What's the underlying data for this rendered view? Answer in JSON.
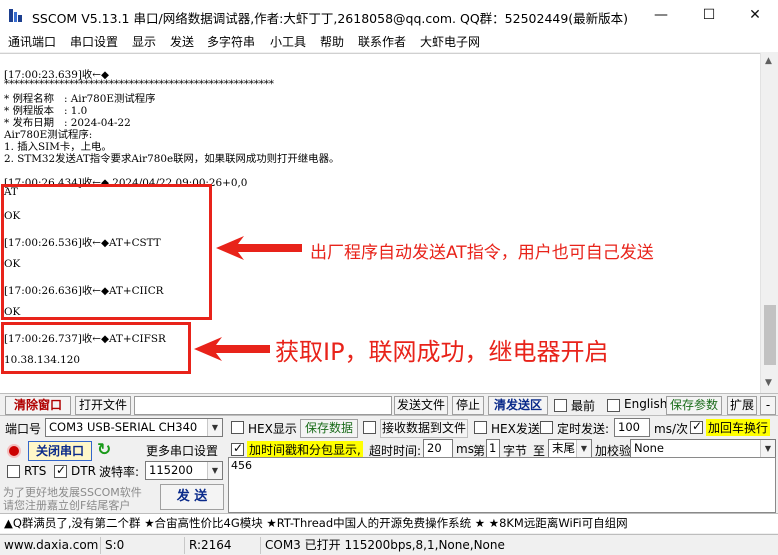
{
  "window": {
    "title": "SSCOM V5.13.1 串口/网络数据调试器,作者:大虾丁丁,2618058@qq.com. QQ群：52502449(最新版本)",
    "controls": {
      "minimize": "—",
      "maximize": "☐",
      "close": "✕"
    }
  },
  "menu": [
    "通讯端口",
    "串口设置",
    "显示",
    "发送",
    "多字符串",
    "小工具",
    "帮助",
    "联系作者",
    "大虾电子网"
  ],
  "receive": {
    "lines": [
      "[17:00:23.639]收←◆",
      "******************************************************",
      "* 例程名称   : Air780E测试程序",
      "* 例程版本   : 1.0",
      "* 发布日期   : 2024-04-22",
      "Air780E测试程序:",
      "1. 插入SIM卡，上电。",
      "2. STM32发送AT指令要求Air780e联网，如果联网成功则打开继电器。",
      "",
      "[17:00:26.434]收←◆ 2024/04/22 09:00:26+0,0",
      "AT",
      "",
      "OK",
      "",
      "[17:00:26.536]收←◆AT+CSTT",
      "",
      "OK",
      "",
      "[17:00:26.636]收←◆AT+CIICR",
      "",
      "OK",
      "",
      "[17:00:26.737]收←◆AT+CIFSR",
      "",
      "10.38.134.120"
    ]
  },
  "annotations": {
    "note1": "出厂程序自动发送AT指令，用户也可自己发送",
    "note2": "获取IP，联网成功，继电器开启",
    "color": "#e8231a"
  },
  "toolbar": {
    "clear_window": "清除窗口",
    "open_file": "打开文件",
    "send_file": "发送文件",
    "stop": "停止",
    "clear_send": "清发送区",
    "topmost": "最前",
    "english": "English",
    "save_params": "保存参数",
    "expand": "扩展",
    "minus": "-"
  },
  "port": {
    "label": "端口号",
    "value": "COM3 USB-SERIAL CH340",
    "close_button": "关闭串口",
    "more_settings": "更多串口设置",
    "rts_label": "RTS",
    "dtr_label": "DTR",
    "baud_label": "波特率:",
    "baud_value": "115200"
  },
  "options": {
    "hex_display": "HEX显示",
    "save_data": "保存数据",
    "recv_to_file": "接收数据到文件",
    "hex_send": "HEX发送",
    "timed_send": "定时发送:",
    "interval_value": "100",
    "interval_unit": "ms/次",
    "add_crlf": "加回车换行",
    "timestamp": "加时间戳和分包显示,",
    "timeout_label": "超时时间:",
    "timeout_value": "20",
    "timeout_unit": "ms",
    "nth_label": "第",
    "nth_value": "1",
    "byte_label": "字节",
    "to_label": "至",
    "to_value": "末尾",
    "checksum_label": "加校验",
    "checksum_value": "None"
  },
  "send": {
    "text": "456",
    "button": "发 送",
    "promo_line1": "为了更好地发展SSCOM软件",
    "promo_line2": "请您注册嘉立创F结尾客户"
  },
  "ticker": "▲Q群满员了,没有第二个群 ★合宙高性价比4G模块 ★RT-Thread中国人的开源免费操作系统 ★ ★8KM远距离WiFi可自组网",
  "status": {
    "website": "www.daxia.com",
    "sent": "S:0",
    "received": "R:2164",
    "port_state": "COM3 已打开  115200bps,8,1,None,None"
  }
}
